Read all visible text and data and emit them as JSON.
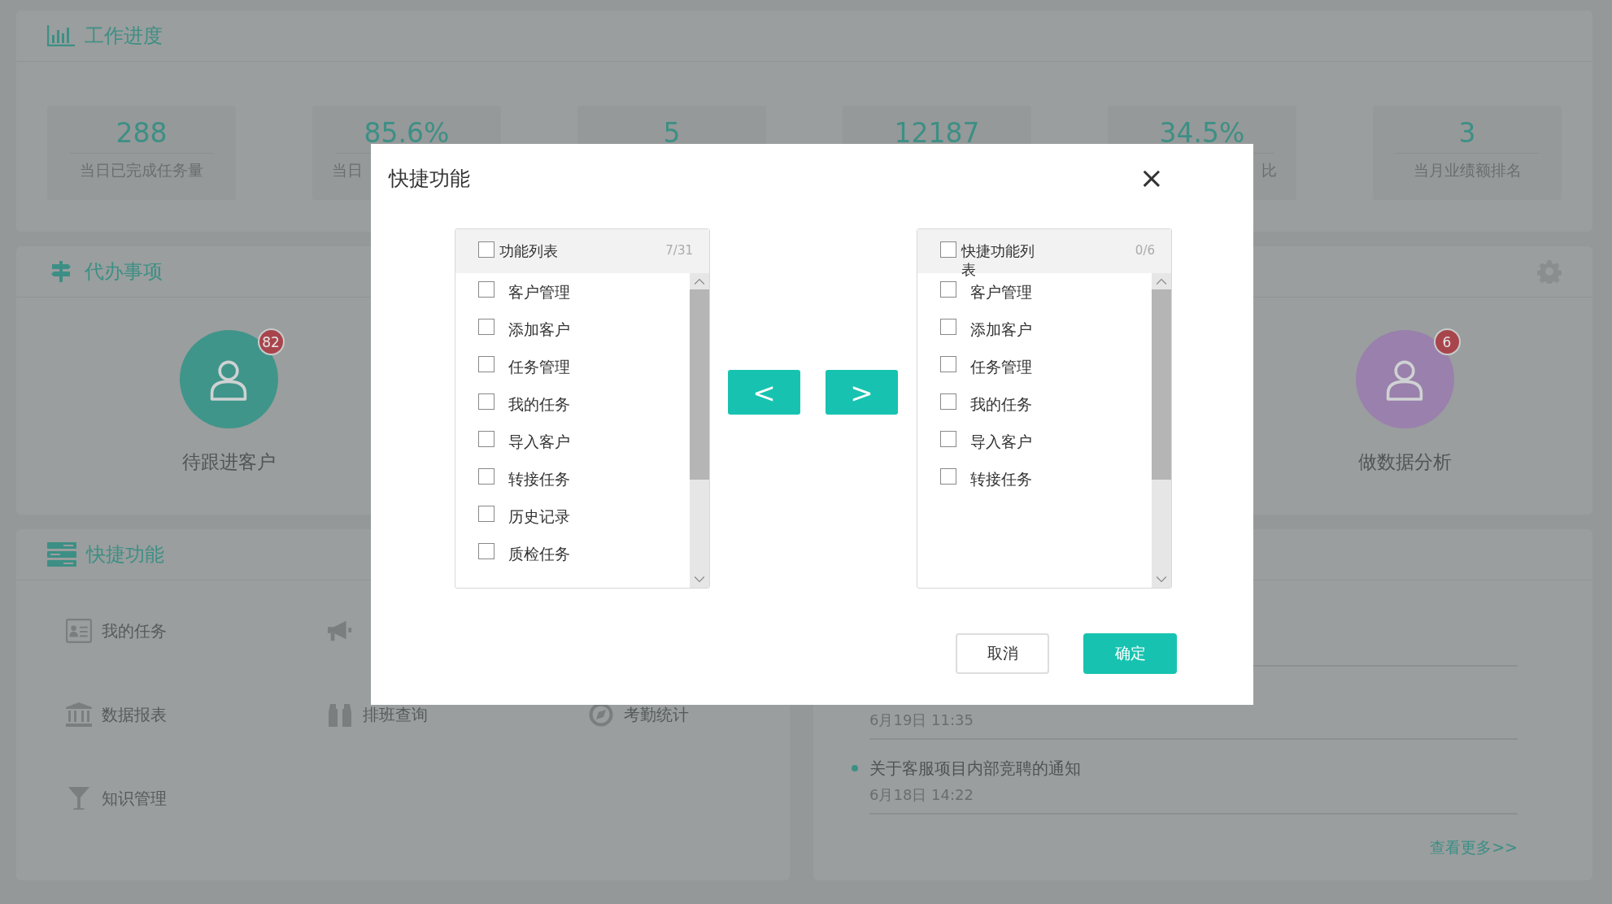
{
  "progress_panel": {
    "title": "工作进度",
    "stats": [
      {
        "value": "288",
        "label": "当日已完成任务量",
        "kind": "full"
      },
      {
        "value": "85.6%",
        "label": "当日",
        "kind": "tail"
      },
      {
        "value": "5",
        "kind": "full"
      },
      {
        "value": "12187",
        "kind": "full"
      },
      {
        "value": "34.5%",
        "label": "比",
        "kind": "head"
      },
      {
        "value": "3",
        "label": "当月业绩额排名",
        "kind": "full"
      }
    ]
  },
  "todo_panel": {
    "title": "代办事项",
    "items": [
      {
        "label": "待跟进客户",
        "badge": "82",
        "color": "#3f958a"
      },
      {
        "label": "做数据分析",
        "badge": "6",
        "color": "#9a80ad"
      }
    ]
  },
  "shortcut_panel": {
    "title": "快捷功能",
    "items": [
      {
        "kind": "card",
        "label": "我的任务"
      },
      {
        "kind": "megaphone"
      },
      {
        "kind": "blank"
      },
      {
        "kind": "bank",
        "label": "数据报表"
      },
      {
        "kind": "binoculars",
        "label": "排班查询"
      },
      {
        "kind": "compass",
        "label": "考勤统计"
      },
      {
        "kind": "funnel",
        "label": "知识管理"
      }
    ]
  },
  "notice_panel": {
    "items": [
      {
        "date": "6月19日  11:35"
      },
      {
        "title": "关于客服项目内部竞聘的通知",
        "date": "6月18日  14:22"
      }
    ],
    "more_link": "查看更多>>"
  },
  "dialog": {
    "title": "快捷功能",
    "close": "×",
    "source": {
      "title": "功能列表",
      "checked": false,
      "count": "7/31",
      "items": [
        {
          "label": "客户管理",
          "checked": false
        },
        {
          "label": "添加客户",
          "checked": false
        },
        {
          "label": "任务管理",
          "checked": false
        },
        {
          "label": "我的任务",
          "checked": false
        },
        {
          "label": "导入客户",
          "checked": false
        },
        {
          "label": "转接任务",
          "checked": false
        },
        {
          "label": "历史记录",
          "checked": false
        },
        {
          "label": "质检任务",
          "checked": false
        }
      ]
    },
    "move_buttons": [
      "<",
      ">"
    ],
    "target": {
      "title": "快捷功能列表",
      "checked": false,
      "count": "0/6",
      "items": [
        {
          "label": "客户管理",
          "checked": false
        },
        {
          "label": "添加客户",
          "checked": false
        },
        {
          "label": "任务管理",
          "checked": false
        },
        {
          "label": "我的任务",
          "checked": false
        },
        {
          "label": "导入客户",
          "checked": false
        },
        {
          "label": "转接任务",
          "checked": false
        }
      ]
    },
    "buttons": [
      {
        "label": "取消",
        "kind": "secondary"
      },
      {
        "label": "确定",
        "kind": "primary"
      }
    ]
  }
}
